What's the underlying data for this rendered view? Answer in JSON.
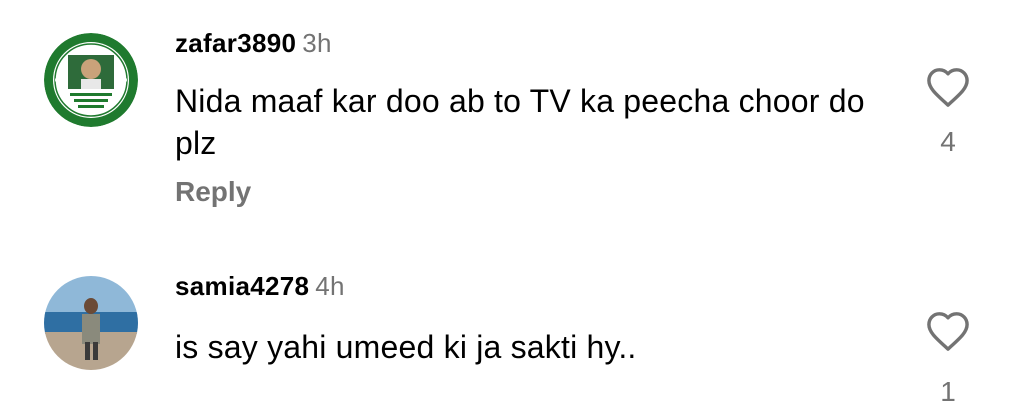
{
  "comments": [
    {
      "username": "zafar3890",
      "time": "3h",
      "text": "Nida maaf kar doo ab to TV ka peecha choor do plz",
      "reply_label": "Reply",
      "likes": "4"
    },
    {
      "username": "samia4278",
      "time": "4h",
      "text": "is say yahi umeed ki ja sakti hy..",
      "likes": "1"
    }
  ],
  "icons": {
    "like": "heart-outline-icon"
  },
  "colors": {
    "text": "#000000",
    "secondary": "#737373",
    "avatar1_ring": "#1f7a2e"
  }
}
